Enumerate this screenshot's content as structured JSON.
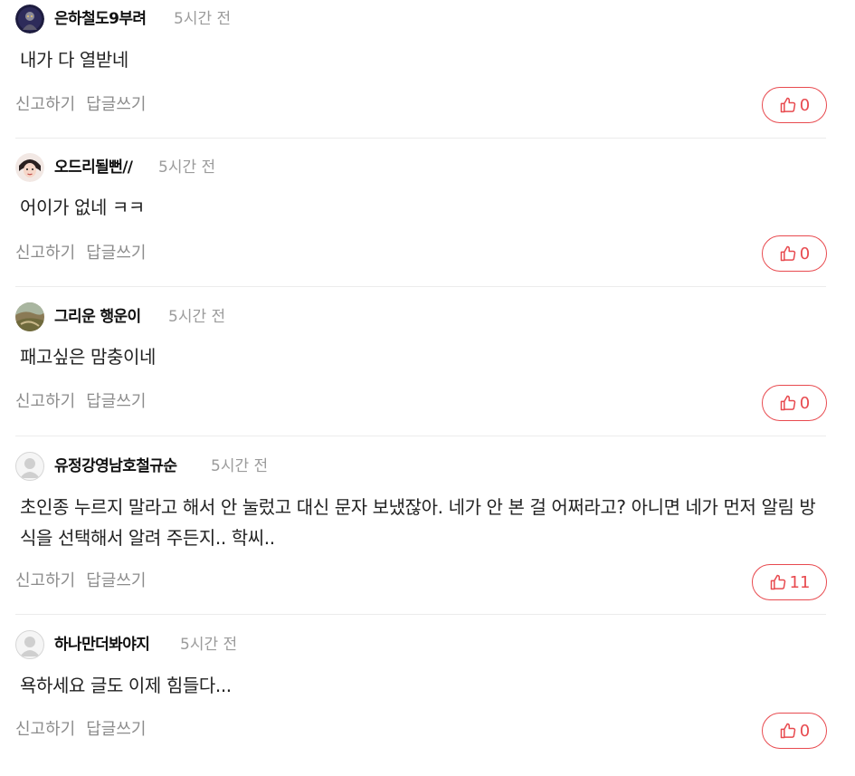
{
  "labels": {
    "report": "신고하기",
    "reply": "답글쓰기"
  },
  "comments": [
    {
      "nickname": "은하철도9부려",
      "time": "5시간 전",
      "text": "내가 다 열받네",
      "likes": "0",
      "avatar": "dark-figure-avatar"
    },
    {
      "nickname": "오드리될뻔//",
      "time": "5시간 전",
      "text": "어이가 없네 ㅋㅋ",
      "likes": "0",
      "avatar": "portrait-avatar"
    },
    {
      "nickname": "그리운 행운이",
      "time": "5시간 전",
      "text": "패고싶은 맘충이네",
      "likes": "0",
      "avatar": "landscape-avatar"
    },
    {
      "nickname": "유정강영남호철규순",
      "time": "5시간 전",
      "text": "초인종 누르지 말라고 해서 안 눌렀고 대신 문자 보냈잖아. 네가 안 본 걸 어쩌라고? 아니면 네가 먼저 알림 방식을 선택해서 알려 주든지.. 학씨..",
      "likes": "11",
      "avatar": "default-user-avatar"
    },
    {
      "nickname": "하나만더봐야지",
      "time": "5시간 전",
      "text": "욕하세요 글도 이제 힘들다...",
      "likes": "0",
      "avatar": "default-user-avatar"
    }
  ],
  "colors": {
    "accent": "#e84a4f",
    "muted": "#8c8c8c",
    "divider": "#ececec"
  },
  "icons": {
    "like": "thumbs-up-icon"
  }
}
